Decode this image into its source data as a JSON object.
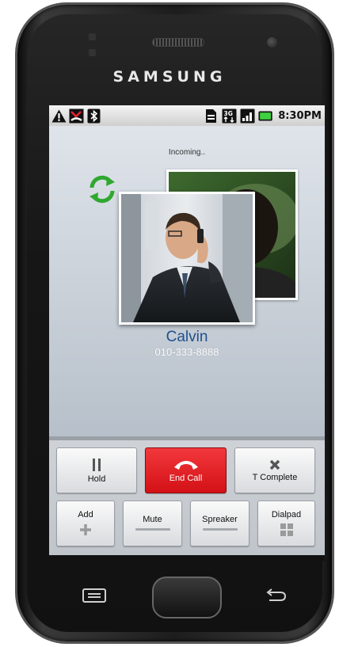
{
  "device": {
    "brand": "SAMSUNG"
  },
  "status_bar": {
    "time": "8:30PM",
    "left_icons": [
      "warning-icon",
      "missed-call-icon",
      "bluetooth-icon"
    ],
    "right_icons": [
      "sd-card-icon",
      "3g-data-icon",
      "signal-icon",
      "battery-icon"
    ]
  },
  "call": {
    "status_text": "Incoming..",
    "caller_name": "Calvin",
    "caller_number": "010-333-8888"
  },
  "controls": {
    "hold_label": "Hold",
    "end_call_label": "End Call",
    "t_complete_label": "T Complete",
    "add_label": "Add",
    "mute_label": "Mute",
    "speaker_label": "Spreaker",
    "dialpad_label": "Dialpad"
  },
  "colors": {
    "end_call": "#e3191e",
    "caller_name": "#1f4f8f",
    "rotate_icon": "#2fa82f"
  }
}
